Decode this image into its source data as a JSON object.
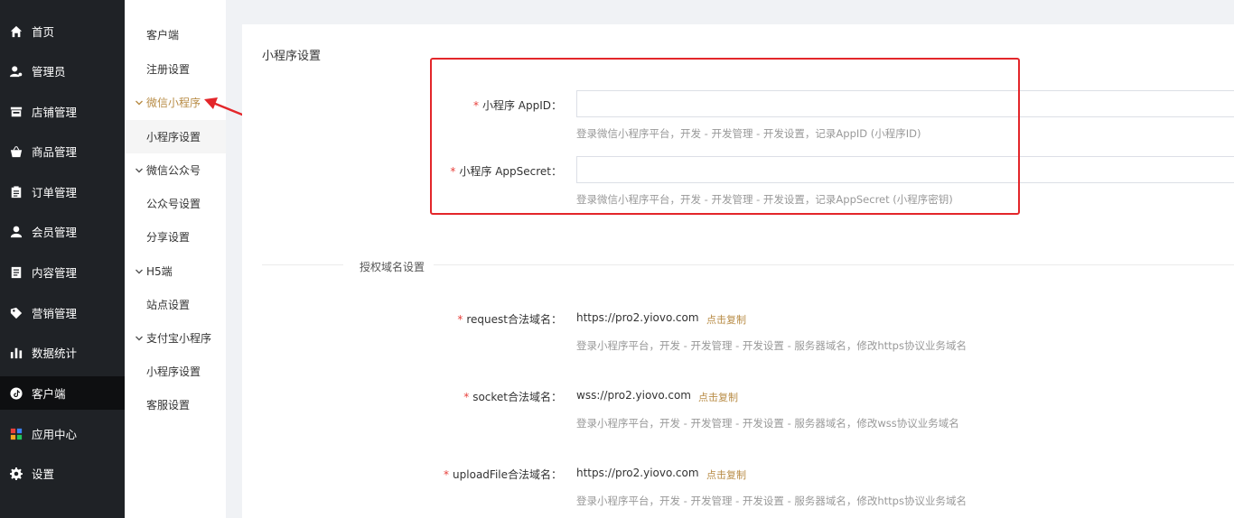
{
  "sidebar": {
    "items": [
      {
        "label": "首页",
        "icon": "home-icon"
      },
      {
        "label": "管理员",
        "icon": "admin-user-icon"
      },
      {
        "label": "店铺管理",
        "icon": "store-icon"
      },
      {
        "label": "商品管理",
        "icon": "shopping-basket-icon"
      },
      {
        "label": "订单管理",
        "icon": "order-clipboard-icon"
      },
      {
        "label": "会员管理",
        "icon": "member-icon"
      },
      {
        "label": "内容管理",
        "icon": "content-icon"
      },
      {
        "label": "营销管理",
        "icon": "marketing-tag-icon"
      },
      {
        "label": "数据统计",
        "icon": "bar-chart-icon"
      },
      {
        "label": "客户端",
        "icon": "tiktok-client-icon"
      },
      {
        "label": "应用中心",
        "icon": "app-grid-icon"
      },
      {
        "label": "设置",
        "icon": "gear-icon"
      }
    ]
  },
  "submenu": {
    "client": "客户端",
    "register": "注册设置",
    "wechat_mini": "微信小程序",
    "mini_settings": "小程序设置",
    "wechat_oa": "微信公众号",
    "oa_settings": "公众号设置",
    "share_settings": "分享设置",
    "h5": "H5端",
    "site_settings": "站点设置",
    "alipay_mini": "支付宝小程序",
    "alipay_mini_settings": "小程序设置",
    "service_settings": "客服设置"
  },
  "form": {
    "section_title": "小程序设置",
    "appid_label": "小程序 AppID：",
    "appid_value": "",
    "appid_hint": "登录微信小程序平台，开发 - 开发管理 - 开发设置，记录AppID (小程序ID)",
    "secret_label": "小程序 AppSecret：",
    "secret_value": "",
    "secret_hint": "登录微信小程序平台，开发 - 开发管理 - 开发设置，记录AppSecret (小程序密钥)",
    "required_mark": "*"
  },
  "domains": {
    "divider": "授权域名设置",
    "copy_label": "点击复制",
    "request_label": "request合法域名：",
    "request_value": "https://pro2.yiovo.com",
    "request_hint": "登录小程序平台，开发 - 开发管理 - 开发设置 - 服务器域名，修改https协议业务域名",
    "socket_label": "socket合法域名：",
    "socket_value": "wss://pro2.yiovo.com",
    "socket_hint": "登录小程序平台，开发 - 开发管理 - 开发设置 - 服务器域名，修改wss协议业务域名",
    "upload_label": "uploadFile合法域名：",
    "upload_value": "https://pro2.yiovo.com",
    "upload_hint": "登录小程序平台，开发 - 开发管理 - 开发设置 - 服务器域名，修改https协议业务域名"
  },
  "colors": {
    "sidebar_bg": "#1f2226",
    "accent": "#b88c46",
    "annotation_red": "#e3262a"
  }
}
